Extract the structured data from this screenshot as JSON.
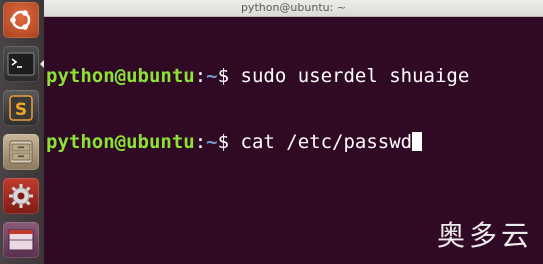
{
  "window": {
    "title": "python@ubuntu: ~"
  },
  "launcher": {
    "items": [
      {
        "name": "ubuntu-dash",
        "icon": "ubuntu-logo-icon"
      },
      {
        "name": "terminal",
        "icon": "terminal-icon",
        "active": true
      },
      {
        "name": "sublime-text",
        "icon": "sublime-s-icon"
      },
      {
        "name": "files",
        "icon": "file-cabinet-icon"
      },
      {
        "name": "system-settings",
        "icon": "gear-wrench-icon"
      },
      {
        "name": "workspace-switcher",
        "icon": "workspace-icon"
      }
    ]
  },
  "terminal": {
    "lines": [
      {
        "user": "python@ubuntu",
        "sep": ":",
        "path": "~",
        "dollar": "$",
        "command": " sudo userdel shuaige"
      },
      {
        "user": "python@ubuntu",
        "sep": ":",
        "path": "~",
        "dollar": "$",
        "command": " cat /etc/passwd"
      }
    ]
  },
  "watermark": {
    "text": "奥多云"
  },
  "colors": {
    "background": "#300a24",
    "prompt_user": "#8ae234",
    "prompt_path": "#729fcf",
    "text": "#ffffff"
  }
}
